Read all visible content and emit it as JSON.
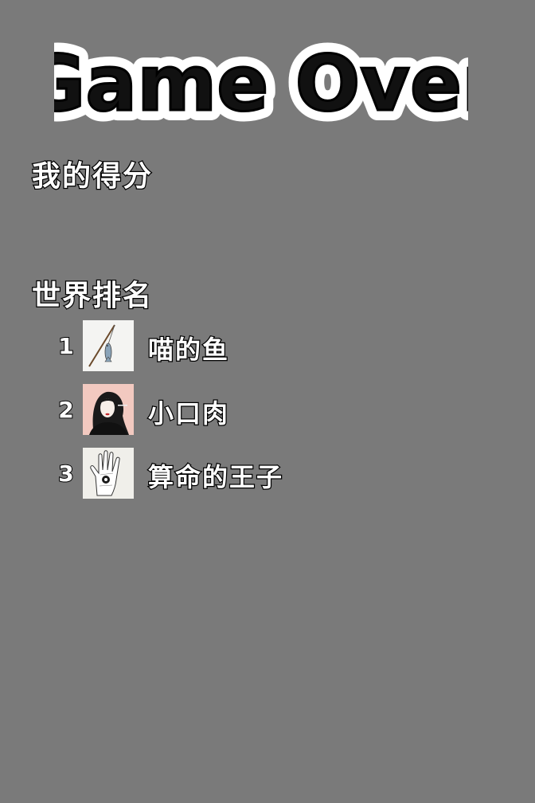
{
  "title": "Game Over",
  "score_label": "我的得分",
  "rank_label": "世界排名",
  "ranking": [
    {
      "rank": "1",
      "name": "喵的鱼",
      "avatar_icon": "fishing-rod-fish-icon"
    },
    {
      "rank": "2",
      "name": "小口肉",
      "avatar_icon": "woman-portrait-icon"
    },
    {
      "rank": "3",
      "name": "算命的王子",
      "avatar_icon": "palm-reading-hand-icon"
    }
  ],
  "colors": {
    "background": "#7a7a7a",
    "text_fill": "#ffffff",
    "text_stroke": "#000000"
  }
}
